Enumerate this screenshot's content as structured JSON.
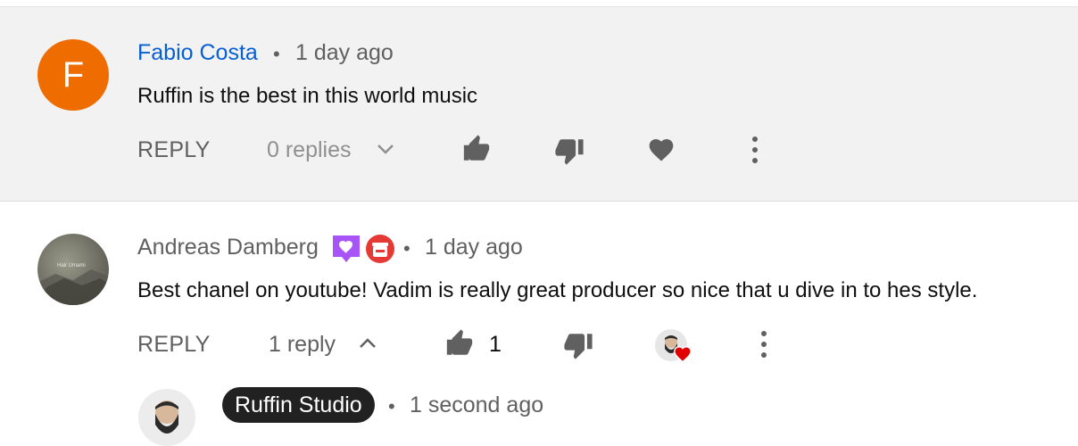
{
  "comments": [
    {
      "avatar_letter": "F",
      "avatar_color": "#ef6c00",
      "author": "Fabio Costa",
      "separator": "•",
      "time": "1 day ago",
      "text": "Ruffin is the best in this world music",
      "reply_label": "REPLY",
      "replies_label": "0 replies",
      "like_count": ""
    },
    {
      "author": "Andreas Damberg",
      "avatar_text": "Hair Umami",
      "separator": "•",
      "time": "1 day ago",
      "text": "Best chanel on youtube! Vadim is really great producer so nice that u dive in to hes style.",
      "reply_label": "REPLY",
      "replies_label": "1 reply",
      "like_count": "1"
    }
  ],
  "reply": {
    "author": "Ruffin Studio",
    "separator": "•",
    "time": "1 second ago"
  },
  "colors": {
    "link_blue": "#065fd4",
    "heart_red": "#e00000",
    "badge_purple": "#a855f7",
    "badge_red": "#e53935"
  },
  "icons": [
    "thumbs-up-icon",
    "thumbs-down-icon",
    "heart-icon",
    "more-vert-icon",
    "chevron-down-icon",
    "chevron-up-icon",
    "member-heart-badge-icon",
    "gift-badge-icon"
  ]
}
